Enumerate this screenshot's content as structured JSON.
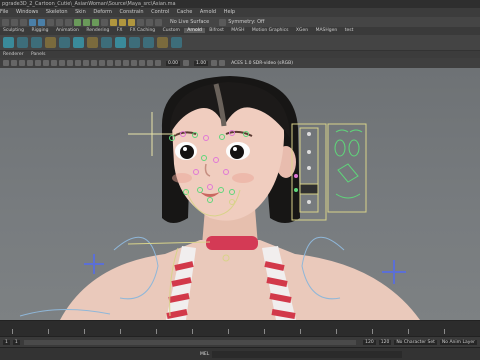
{
  "window": {
    "title": "pgrade3D_2_Cartoon_Cutie\\_AsianWoman\\Source\\Maya_src\\Asian.ma"
  },
  "menubar": [
    "File",
    "Windows",
    "Skeleton",
    "Skin",
    "Deform",
    "Constrain",
    "Control",
    "Cache",
    "Arnold",
    "Help"
  ],
  "statusline": {
    "live_surface": "No Live Surface",
    "symmetry": "Symmetry: Off"
  },
  "shelf_tabs": [
    "Sculpting",
    "Rigging",
    "Animation",
    "Rendering",
    "FX",
    "FX Caching",
    "Custom",
    "Arnold",
    "Bifrost",
    "MASH",
    "Motion Graphics",
    "XGen",
    "MASHgen",
    "test"
  ],
  "active_shelf_tab": "Arnold",
  "panel_menu": [
    "Renderer",
    "Panels"
  ],
  "panel_toolbar": {
    "value_a": "0.00",
    "value_b": "1.00",
    "colorspace": "ACES 1.0 SDR-video (sRGB)"
  },
  "range_bar": {
    "start": "1",
    "end": "120",
    "character_set": "No Character Set",
    "anim_layer": "No Anim Layer"
  },
  "command_line": {
    "label": "MEL"
  },
  "colors": {
    "viewport_top": "#6e7275",
    "shelf_icon": "#3d6d7a",
    "rig_blue": "#5b6fd6",
    "rig_yellow": "#d8d38a",
    "rig_green": "#5fd67a"
  },
  "icons": [
    "shelf-tool-icon",
    "viewport-tool-icon",
    "rig-locator-cross-icon",
    "face-control-panel-icon"
  ]
}
